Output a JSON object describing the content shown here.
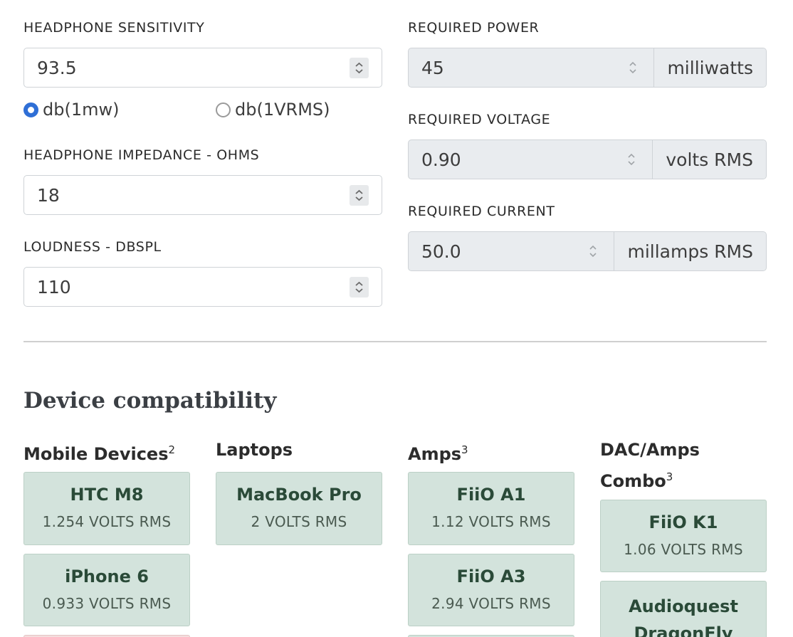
{
  "inputs": {
    "sensitivity": {
      "label": "HEADPHONE SENSITIVITY",
      "value": "93.5"
    },
    "units": {
      "option1": "db(1mw)",
      "option2": "db(1VRMS)",
      "selected": "db(1mw)"
    },
    "impedance": {
      "label": "HEADPHONE IMPEDANCE - OHMS",
      "value": "18"
    },
    "loudness": {
      "label": "LOUDNESS - DBSPL",
      "value": "110"
    }
  },
  "outputs": {
    "power": {
      "label": "REQUIRED POWER",
      "value": "45",
      "unit": "milliwatts"
    },
    "voltage": {
      "label": "REQUIRED VOLTAGE",
      "value": "0.90",
      "unit": "volts RMS"
    },
    "current": {
      "label": "REQUIRED CURRENT",
      "value": "50.0",
      "unit": "millamps RMS"
    }
  },
  "compatibility": {
    "title": "Device compatibility",
    "columns": [
      {
        "title": "Mobile Devices",
        "sup": "2",
        "devices": [
          {
            "name": "HTC M8",
            "spec": "1.254 VOLTS RMS"
          },
          {
            "name": "iPhone 6",
            "spec": "0.933 VOLTS RMS"
          }
        ]
      },
      {
        "title": "Laptops",
        "sup": "",
        "devices": [
          {
            "name": "MacBook Pro",
            "spec": "2 VOLTS RMS"
          }
        ]
      },
      {
        "title": "Amps",
        "sup": "3",
        "devices": [
          {
            "name": "FiiO A1",
            "spec": "1.12 VOLTS RMS"
          },
          {
            "name": "FiiO A3",
            "spec": "2.94 VOLTS RMS"
          }
        ]
      },
      {
        "title_line1": "DAC/Amps",
        "title_line2": "Combo",
        "sup": "3",
        "devices": [
          {
            "name": "FiiO K1",
            "spec": "1.06 VOLTS RMS"
          },
          {
            "name_line1": "Audioquest",
            "name_line2": "DragonFly"
          }
        ]
      }
    ]
  },
  "colors": {
    "card_ok": "#d3e3dc",
    "radio_accent": "#2f6fd6",
    "card_warn": "#f4dede"
  }
}
